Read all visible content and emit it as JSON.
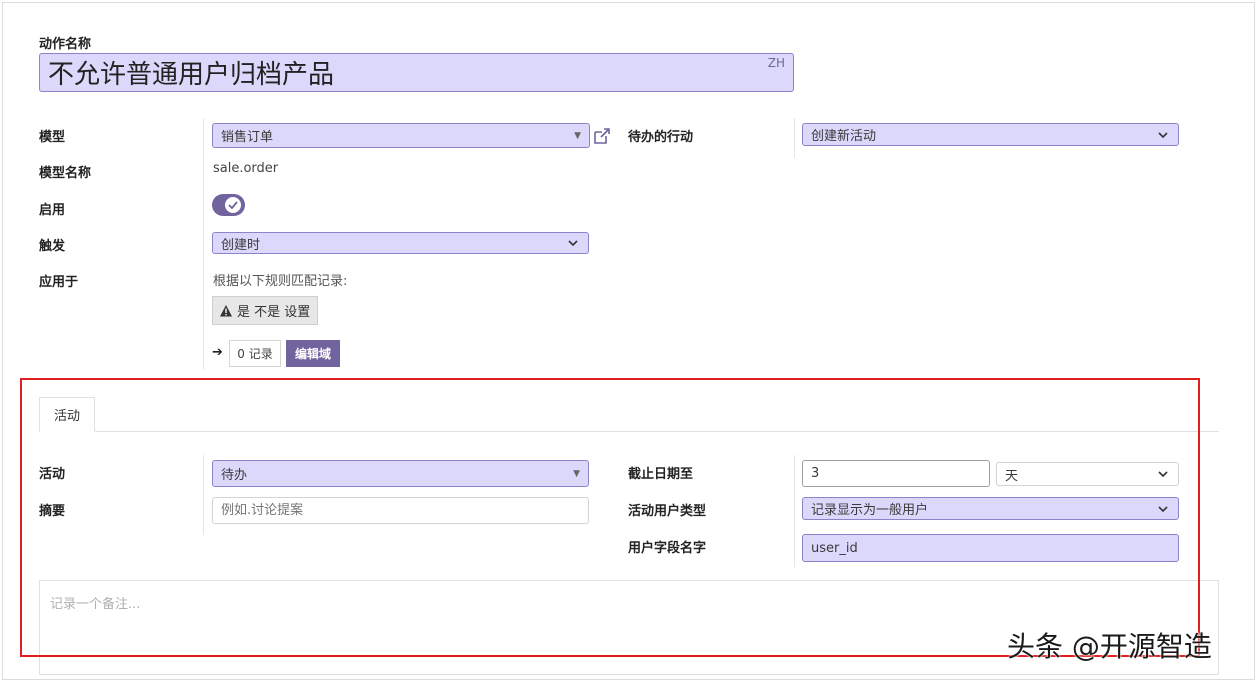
{
  "form": {
    "action_name_label": "动作名称",
    "action_name_value": "不允许普通用户归档产品",
    "lang_badge": "ZH",
    "model_label": "模型",
    "model_value": "销售订单",
    "model_name_label": "模型名称",
    "model_name_value": "sale.order",
    "active_label": "启用",
    "trigger_label": "触发",
    "trigger_value": "创建时",
    "apply_on_label": "应用于",
    "apply_on_text": "根据以下规则匹配记录:",
    "domain_tag": "是 不是 设置",
    "records_count": "0 记录",
    "edit_domain_button": "编辑域",
    "todo_action_label": "待办的行动",
    "todo_action_value": "创建新活动"
  },
  "tabs": [
    {
      "label": "活动"
    }
  ],
  "activity": {
    "activity_label": "活动",
    "activity_value": "待办",
    "summary_label": "摘要",
    "summary_placeholder": "例如.讨论提案",
    "deadline_label": "截止日期至",
    "deadline_value": "3",
    "deadline_unit": "天",
    "user_type_label": "活动用户类型",
    "user_type_value": "记录显示为一般用户",
    "user_field_label": "用户字段名字",
    "user_field_value": "user_id",
    "note_placeholder": "记录一个备注..."
  },
  "watermark": "头条 @开源智造",
  "colors": {
    "accent": "#71639e",
    "field_bg": "#dcd8fb",
    "highlight_box": "#e02020"
  }
}
